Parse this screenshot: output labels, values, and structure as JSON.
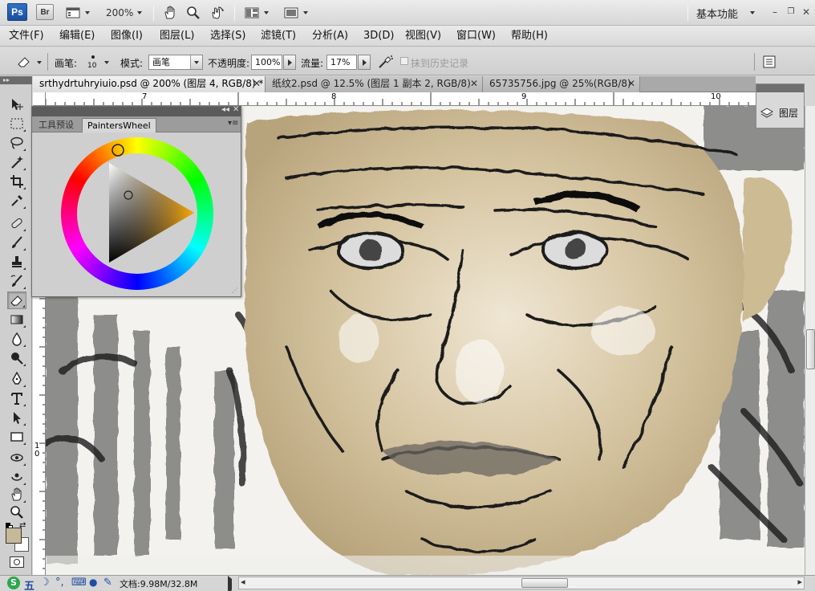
{
  "app_bar": {
    "logo": "Ps",
    "bridge": "Br",
    "zoom": "200%",
    "workspace": "基本功能",
    "icons": [
      "hand-icon",
      "zoom-icon",
      "rotate-view-icon",
      "arrange-documents-icon",
      "screen-mode-icon"
    ]
  },
  "menu": [
    "文件(F)",
    "编辑(E)",
    "图像(I)",
    "图层(L)",
    "选择(S)",
    "滤镜(T)",
    "分析(A)",
    "3D(D)",
    "视图(V)",
    "窗口(W)",
    "帮助(H)"
  ],
  "options": {
    "brush_label": "画笔:",
    "brush_size": "10",
    "mode_label": "模式:",
    "mode_value": "画笔",
    "opacity_label": "不透明度:",
    "opacity_value": "100%",
    "flow_label": "流量:",
    "flow_value": "17%",
    "erase_history_label": "抹到历史记录",
    "erase_history_checked": false
  },
  "tabs": [
    {
      "label": "srthydrtuhryiuio.psd @ 200% (图层 4, RGB/8) *",
      "active": true
    },
    {
      "label": "纸纹2.psd @ 12.5% (图层 1 副本 2, RGB/8)",
      "active": false
    },
    {
      "label": "65735756.jpg @ 25%(RGB/8)",
      "active": false
    }
  ],
  "ruler": {
    "h_labels": [
      "7",
      "8",
      "9",
      "10"
    ],
    "v_labels": [
      "1",
      "0"
    ]
  },
  "panels": {
    "layers_label": "图层",
    "pw_tabs": [
      "工具预设",
      "PaintersWheel"
    ]
  },
  "status": {
    "doc_info": "文档:9.98M/32.8M",
    "ime_label": "五"
  },
  "colors": {
    "foreground": "#c8b89a",
    "background": "#ffffff",
    "accent": "#2f73c8"
  }
}
